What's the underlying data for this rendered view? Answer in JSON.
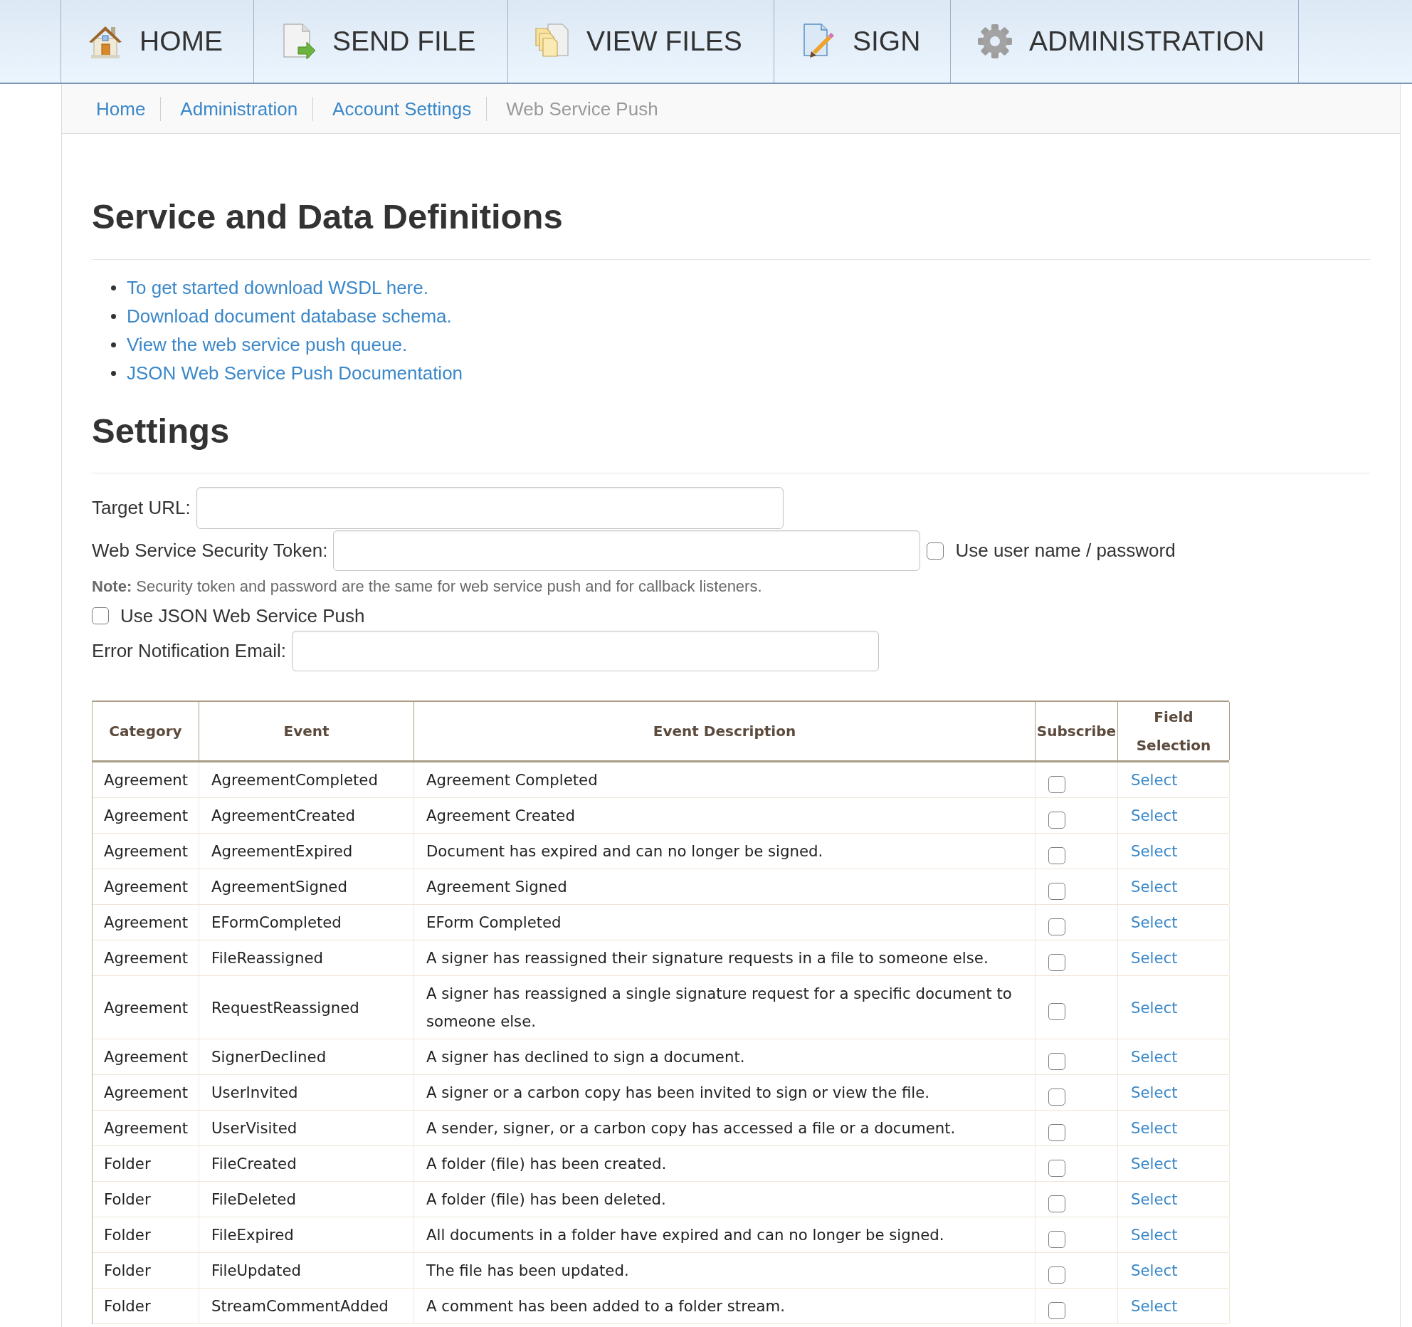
{
  "nav_tabs": [
    {
      "label": "HOME"
    },
    {
      "label": "SEND FILE"
    },
    {
      "label": "VIEW FILES"
    },
    {
      "label": "SIGN"
    },
    {
      "label": "ADMINISTRATION"
    }
  ],
  "breadcrumb": [
    {
      "label": "Home",
      "current": false
    },
    {
      "label": "Administration",
      "current": false
    },
    {
      "label": "Account Settings",
      "current": false
    },
    {
      "label": "Web Service Push",
      "current": true
    }
  ],
  "definitions": {
    "heading": "Service and Data Definitions",
    "links": [
      "To get started download WSDL here.",
      "Download document database schema.",
      "View the web service push queue.",
      "JSON Web Service Push Documentation"
    ]
  },
  "settings": {
    "heading": "Settings",
    "target_url": {
      "label": "Target URL:"
    },
    "security_token": {
      "label": "Web Service Security Token:"
    },
    "use_credentials": {
      "label": "Use user name / password",
      "checked": false
    },
    "note": "**Note:** Security token and password are the same for web service push and for callback listeners.",
    "json_push": {
      "label": "Use JSON Web Service Push",
      "checked": false
    },
    "error_email": {
      "label": "Error Notification Email:"
    }
  },
  "table": {
    "columns": [
      "Category",
      "Event",
      "Event Description",
      "Subscribe",
      "Field Selection"
    ],
    "rows": [
      {
        "category": "Agreement",
        "event": "AgreementCompleted",
        "description": "Agreement Completed",
        "checked": false,
        "field_selection": "Select"
      },
      {
        "category": "Agreement",
        "event": "AgreementCreated",
        "description": "Agreement Created",
        "checked": false,
        "field_selection": "Select"
      },
      {
        "category": "Agreement",
        "event": "AgreementExpired",
        "description": "Document has expired and can no longer be signed.",
        "checked": false,
        "field_selection": "Select"
      },
      {
        "category": "Agreement",
        "event": "AgreementSigned",
        "description": "Agreement Signed",
        "checked": false,
        "field_selection": "Select"
      },
      {
        "category": "Agreement",
        "event": "EFormCompleted",
        "description": "EForm Completed",
        "checked": false,
        "field_selection": "Select"
      },
      {
        "category": "Agreement",
        "event": "FileReassigned",
        "description": "A signer has reassigned their signature requests in a file to someone else.",
        "checked": false,
        "field_selection": "Select"
      },
      {
        "category": "Agreement",
        "event": "RequestReassigned",
        "description": "A signer has reassigned a single signature request for a specific document to someone else.",
        "checked": false,
        "field_selection": "Select"
      },
      {
        "category": "Agreement",
        "event": "SignerDeclined",
        "description": "A signer has declined to sign a document.",
        "checked": false,
        "field_selection": "Select"
      },
      {
        "category": "Agreement",
        "event": "UserInvited",
        "description": "A signer or a carbon copy has been invited to sign or view the file.",
        "checked": false,
        "field_selection": "Select"
      },
      {
        "category": "Agreement",
        "event": "UserVisited",
        "description": "A sender, signer, or a carbon copy has accessed a file or a document.",
        "checked": false,
        "field_selection": "Select"
      },
      {
        "category": "Folder",
        "event": "FileCreated",
        "description": "A folder (file) has been created.",
        "checked": false,
        "field_selection": "Select"
      },
      {
        "category": "Folder",
        "event": "FileDeleted",
        "description": "A folder (file) has been deleted.",
        "checked": false,
        "field_selection": "Select"
      },
      {
        "category": "Folder",
        "event": "FileExpired",
        "description": "All documents in a folder have expired and can no longer be signed.",
        "checked": false,
        "field_selection": "Select"
      },
      {
        "category": "Folder",
        "event": "FileUpdated",
        "description": "The file has been updated.",
        "checked": false,
        "field_selection": "Select"
      },
      {
        "category": "Folder",
        "event": "StreamCommentAdded",
        "description": "A comment has been added to a folder stream.",
        "checked": false,
        "field_selection": "Select"
      }
    ]
  }
}
